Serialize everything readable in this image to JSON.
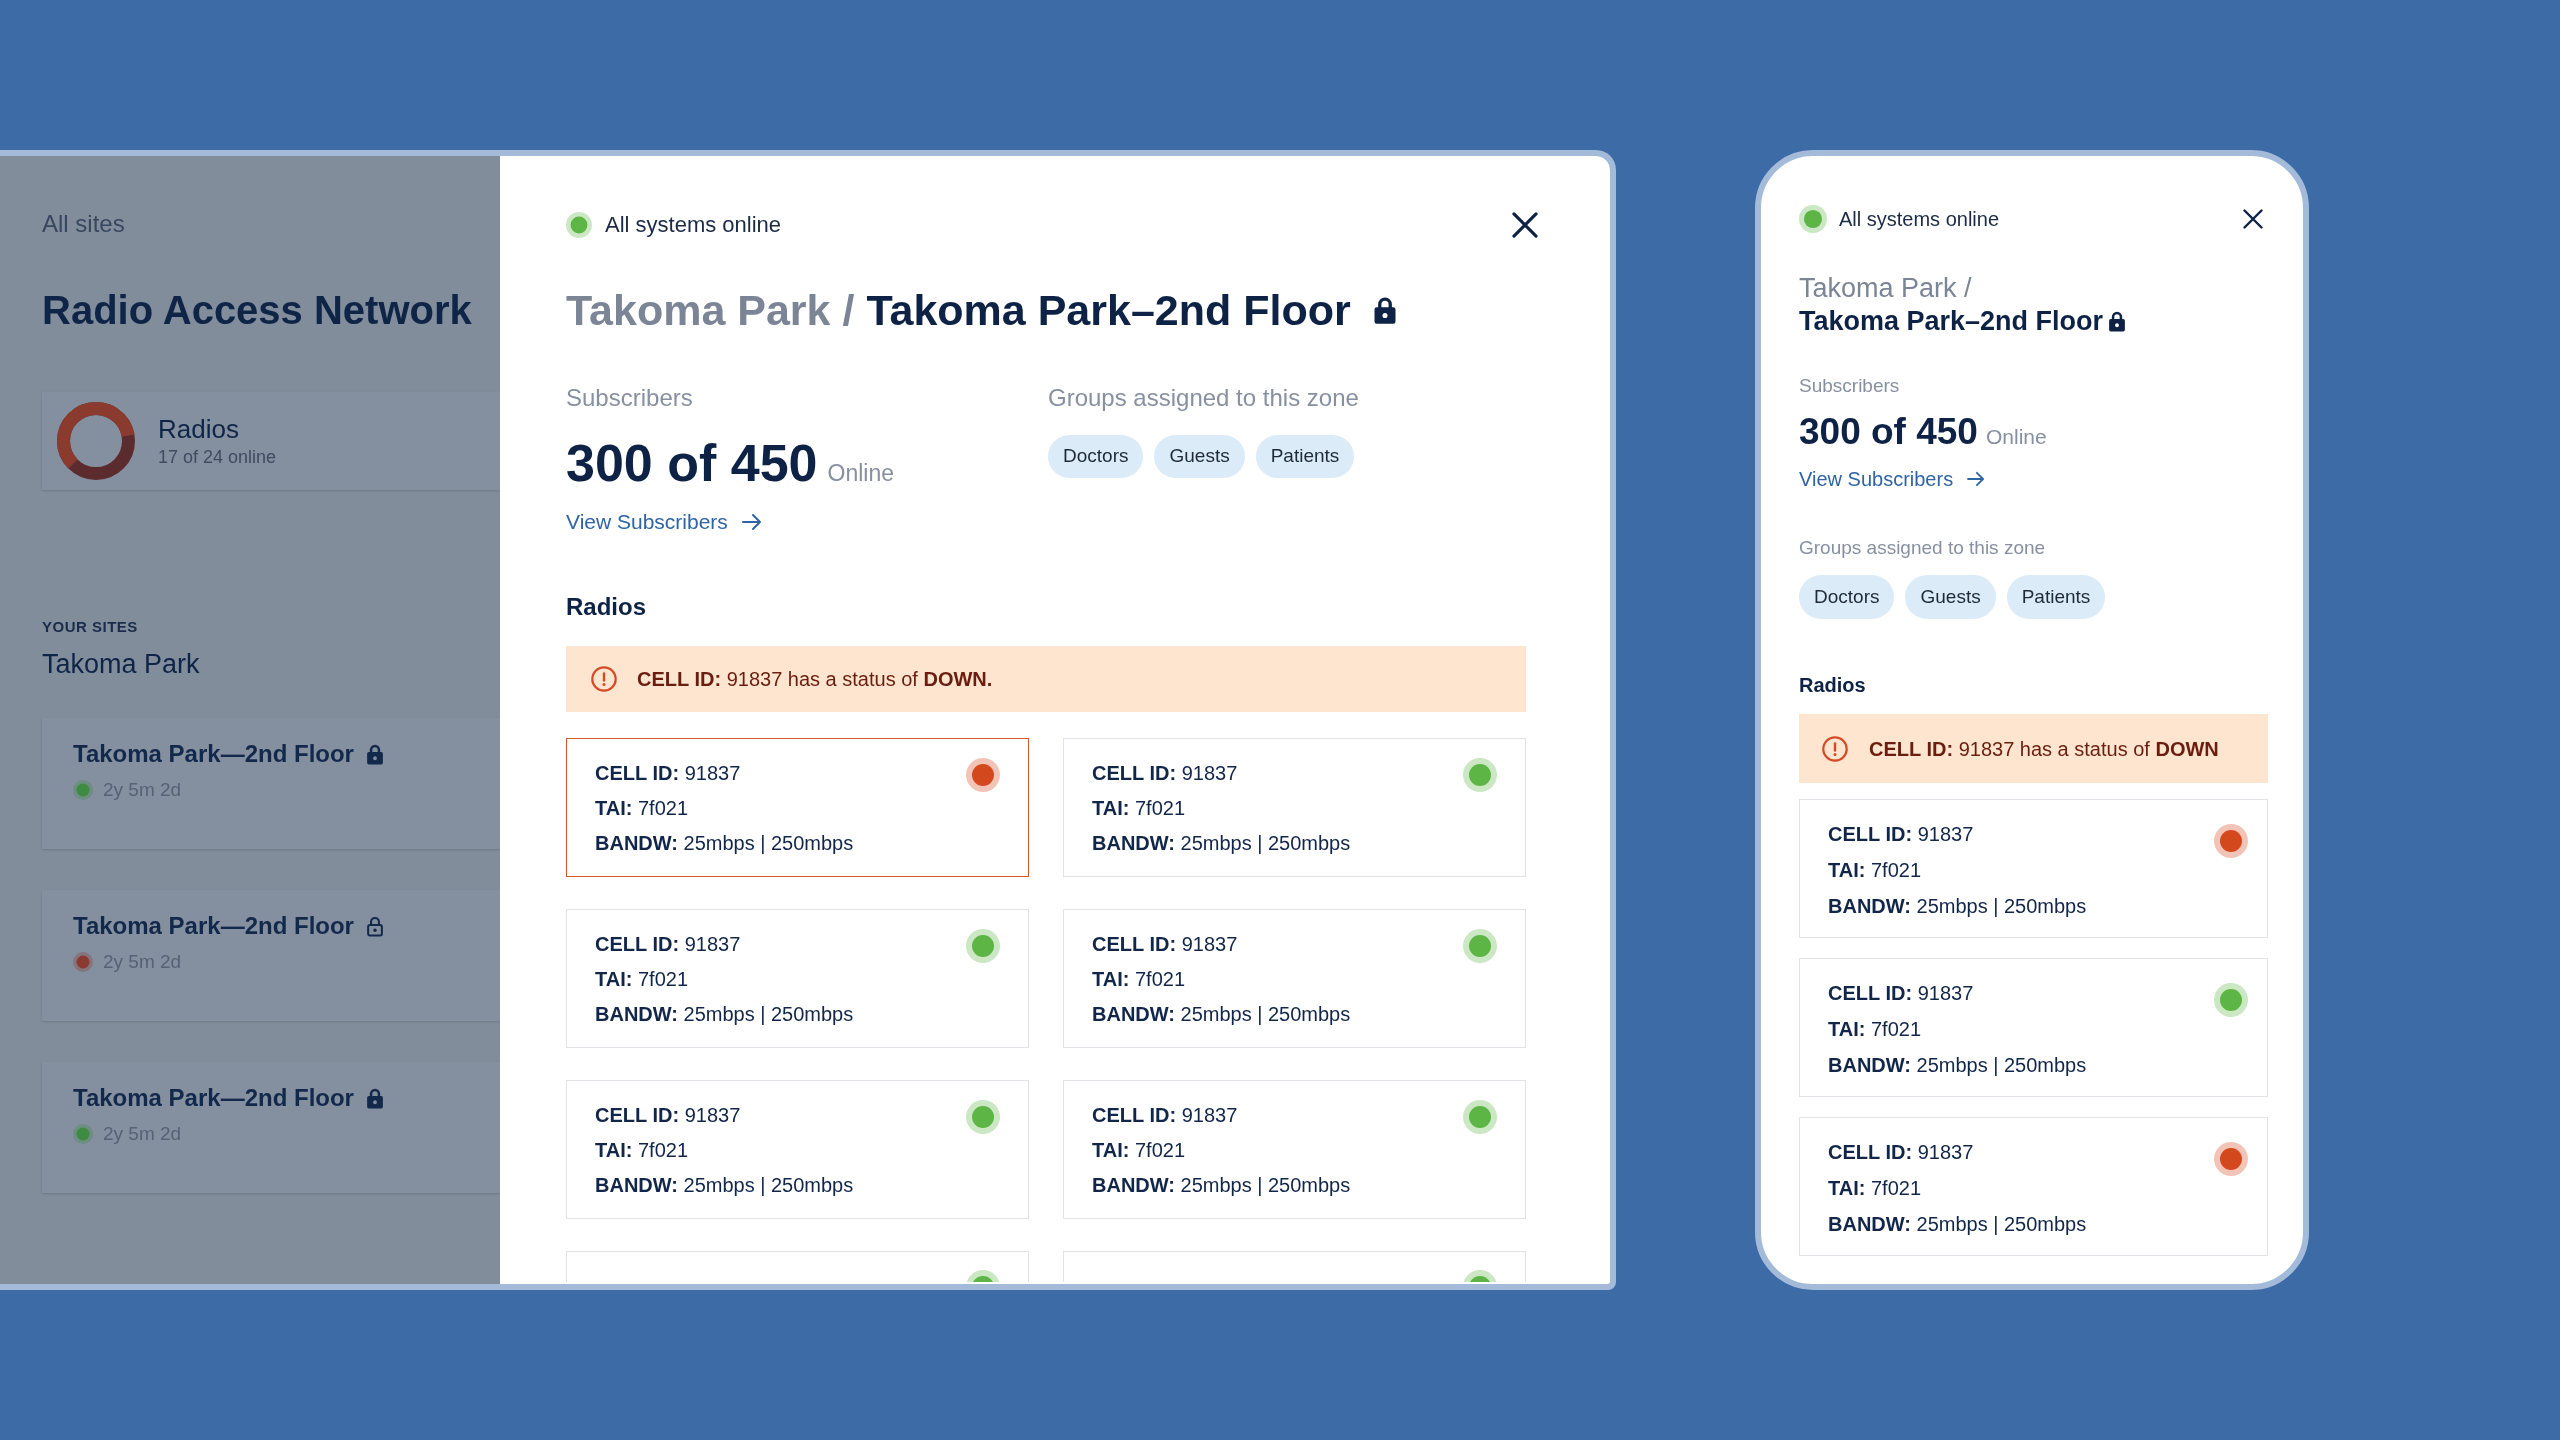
{
  "desktop": {
    "sidebar": {
      "back_link": "All sites",
      "title": "Radio Access Network",
      "summary": {
        "title": "Radios",
        "detail": "17 of 24 online"
      },
      "sites_label": "YOUR SITES",
      "site_group": "Takoma Park",
      "sites": [
        {
          "name": "Takoma Park—2nd Floor",
          "lock_filled": true,
          "color": "#3e8b42",
          "uptime": "2y 5m 2d"
        },
        {
          "name": "Takoma Park—2nd Floor",
          "lock_filled": false,
          "color": "#8c3a31",
          "uptime": "2y 5m 2d"
        },
        {
          "name": "Takoma Park—2nd Floor",
          "lock_filled": true,
          "color": "#3e8b42",
          "uptime": "2y 5m 2d"
        }
      ]
    },
    "modal": {
      "status": {
        "text": "All systems online",
        "color": "#5cb545"
      },
      "breadcrumb": "Takoma Park /",
      "title": "Takoma Park–2nd Floor",
      "subscribers": {
        "label": "Subscribers",
        "count": "300 of 450",
        "unit": "Online",
        "link": "View Subscribers"
      },
      "groups": {
        "label": "Groups assigned to this zone",
        "chips": [
          "Doctors",
          "Guests",
          "Patients"
        ]
      },
      "radios": {
        "heading": "Radios",
        "alert": "**CELL ID:** 91837 has a status of **DOWN.**",
        "cards": [
          {
            "kind": "full",
            "highlighted": true,
            "color": "#d4481e",
            "lines": [
              "**CELL ID:** 91837",
              "**TAI:** 7f021",
              "**BANDW:** 25mbps | 250mbps"
            ]
          },
          {
            "kind": "full",
            "highlighted": false,
            "color": "#5cb545",
            "lines": [
              "**CELL ID:** 91837",
              "**TAI:** 7f021",
              "**BANDW:** 25mbps | 250mbps"
            ]
          },
          {
            "kind": "full",
            "highlighted": false,
            "color": "#5cb545",
            "lines": [
              "**CELL ID:** 91837",
              "**TAI:** 7f021",
              "**BANDW:** 25mbps | 250mbps"
            ]
          },
          {
            "kind": "full",
            "highlighted": false,
            "color": "#5cb545",
            "lines": [
              "**CELL ID:** 91837",
              "**TAI:** 7f021",
              "**BANDW:** 25mbps | 250mbps"
            ]
          },
          {
            "kind": "full",
            "highlighted": false,
            "color": "#5cb545",
            "lines": [
              "**CELL ID:** 91837",
              "**TAI:** 7f021",
              "**BANDW:** 25mbps | 250mbps"
            ]
          },
          {
            "kind": "full",
            "highlighted": false,
            "color": "#5cb545",
            "lines": [
              "**CELL ID:** 91837",
              "**TAI:** 7f021",
              "**BANDW:** 25mbps | 250mbps"
            ]
          },
          {
            "kind": "clipped",
            "highlighted": false,
            "color": "#5cb545"
          },
          {
            "kind": "clipped",
            "highlighted": false,
            "color": "#5cb545"
          }
        ]
      }
    }
  },
  "mobile": {
    "modal": {
      "status": {
        "text": "All systems online",
        "color": "#5cb545"
      },
      "breadcrumb": "Takoma Park /",
      "title": "Takoma Park–2nd Floor",
      "subscribers": {
        "label": "Subscribers",
        "count": "300 of 450",
        "unit": "Online",
        "link": "View Subscribers"
      },
      "groups": {
        "label": "Groups assigned to this zone",
        "chips": [
          "Doctors",
          "Guests",
          "Patients"
        ]
      },
      "radios": {
        "heading": "Radios",
        "alert": "**CELL ID:** 91837 has a status of **DOWN**",
        "cards": [
          {
            "kind": "full",
            "highlighted": false,
            "color": "#d4481e",
            "lines": [
              "**CELL ID:** 91837",
              "**TAI:** 7f021",
              "**BANDW:** 25mbps | 250mbps"
            ]
          },
          {
            "kind": "full",
            "highlighted": false,
            "color": "#5cb545",
            "lines": [
              "**CELL ID:** 91837",
              "**TAI:** 7f021",
              "**BANDW:** 25mbps | 250mbps"
            ]
          },
          {
            "kind": "full",
            "highlighted": false,
            "color": "#d4481e",
            "lines": [
              "**CELL ID:** 91837",
              "**TAI:** 7f021",
              "**BANDW:** 25mbps | 250mbps"
            ]
          }
        ]
      }
    }
  }
}
